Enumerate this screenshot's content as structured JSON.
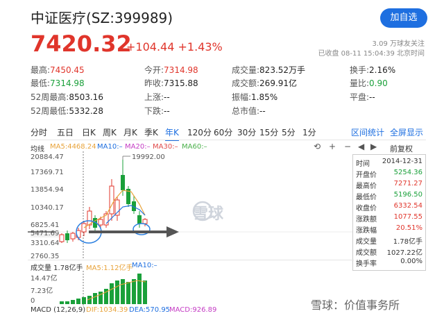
{
  "header": {
    "title": "中证医疗(SZ:399989)",
    "add_label": "加自选",
    "price": "7420.32",
    "change": "+104.44 +1.43%",
    "followers": "3.09 万球友关注",
    "status": "已收盘 08-11 15:04:39 北京时间"
  },
  "stats": {
    "high_label": "最高:",
    "high": "7450.45",
    "open_label": "今开:",
    "open": "7314.98",
    "volume_label": "成交量:",
    "volume": "823.52万手",
    "turnover_label": "换手:",
    "turnover": "2.16%",
    "low_label": "最低:",
    "low": "7314.98",
    "prev_label": "昨收:",
    "prev": "7315.88",
    "amount_label": "成交额:",
    "amount": "269.91亿",
    "vol_ratio_label": "量比:",
    "vol_ratio": "0.90",
    "w52h_label": "52周最高:",
    "w52h": "8503.16",
    "up_label": "上涨:",
    "up": "--",
    "amp_label": "振幅:",
    "amp": "1.85%",
    "flat_label": "平盘:",
    "flat": "--",
    "w52l_label": "52周最低:",
    "w52l": "5332.28",
    "down_label": "下跌:",
    "down": "--",
    "mcap_label": "总市值:",
    "mcap": "--"
  },
  "tabs": {
    "items": [
      "分时",
      "五日",
      "日K",
      "周K",
      "月K",
      "季K",
      "年K",
      "120分",
      "60分",
      "30分",
      "15分",
      "5分",
      "1分"
    ],
    "active": "年K",
    "interval": "区间统计",
    "fullscreen": "全屏显示"
  },
  "ma": {
    "label": "均线",
    "ma5": "MA5:4468.24",
    "ma10": "MA10:–",
    "ma20": "MA20:–",
    "ma30": "MA30:–",
    "ma60": "MA60:–",
    "adjust": "前复权"
  },
  "yaxis": [
    "20884.47",
    "17369.71",
    "13854.94",
    "10340.17",
    "6825.41",
    "5471.69",
    "3310.64",
    "2760.35"
  ],
  "peak_label": "19992.00",
  "info": {
    "rows": [
      {
        "k": "时间",
        "v": "2014-12-31",
        "c": "#333333"
      },
      {
        "k": "开盘价",
        "v": "5254.36",
        "c": "#1aa03a"
      },
      {
        "k": "最高价",
        "v": "7271.27",
        "c": "#e0352b"
      },
      {
        "k": "最低价",
        "v": "5196.50",
        "c": "#1aa03a"
      },
      {
        "k": "收盘价",
        "v": "6332.54",
        "c": "#e0352b"
      },
      {
        "k": "涨跌额",
        "v": "1077.55",
        "c": "#e0352b"
      },
      {
        "k": "涨跌幅",
        "v": "20.51%",
        "c": "#e0352b"
      },
      {
        "k": "成交量",
        "v": "1.78亿手",
        "c": "#333333"
      },
      {
        "k": "成交额",
        "v": "1027.22亿",
        "c": "#333333"
      },
      {
        "k": "换手率",
        "v": "0.00%",
        "c": "#333333"
      }
    ]
  },
  "volume": {
    "label": "成交量 1.78亿手",
    "ma5": "MA5:1.12亿手",
    "ma10": "MA10:–",
    "ticks": [
      "14.47亿",
      "7.23亿",
      "0"
    ]
  },
  "macd": {
    "label": "MACD (12,26,9)",
    "dif": "DIF:1034.39",
    "dea": "DEA:570.95",
    "macd": "MACD:926.89"
  },
  "watermark": {
    "center": "雪球",
    "corner": "雪球：价值事务所"
  },
  "colors": {
    "up": "#e0352b",
    "down": "#1aa03a",
    "accent": "#1e6fe0"
  },
  "icons": [
    "undo-icon",
    "zoom-in-icon",
    "zoom-out-icon",
    "prev-icon",
    "next-icon"
  ]
}
